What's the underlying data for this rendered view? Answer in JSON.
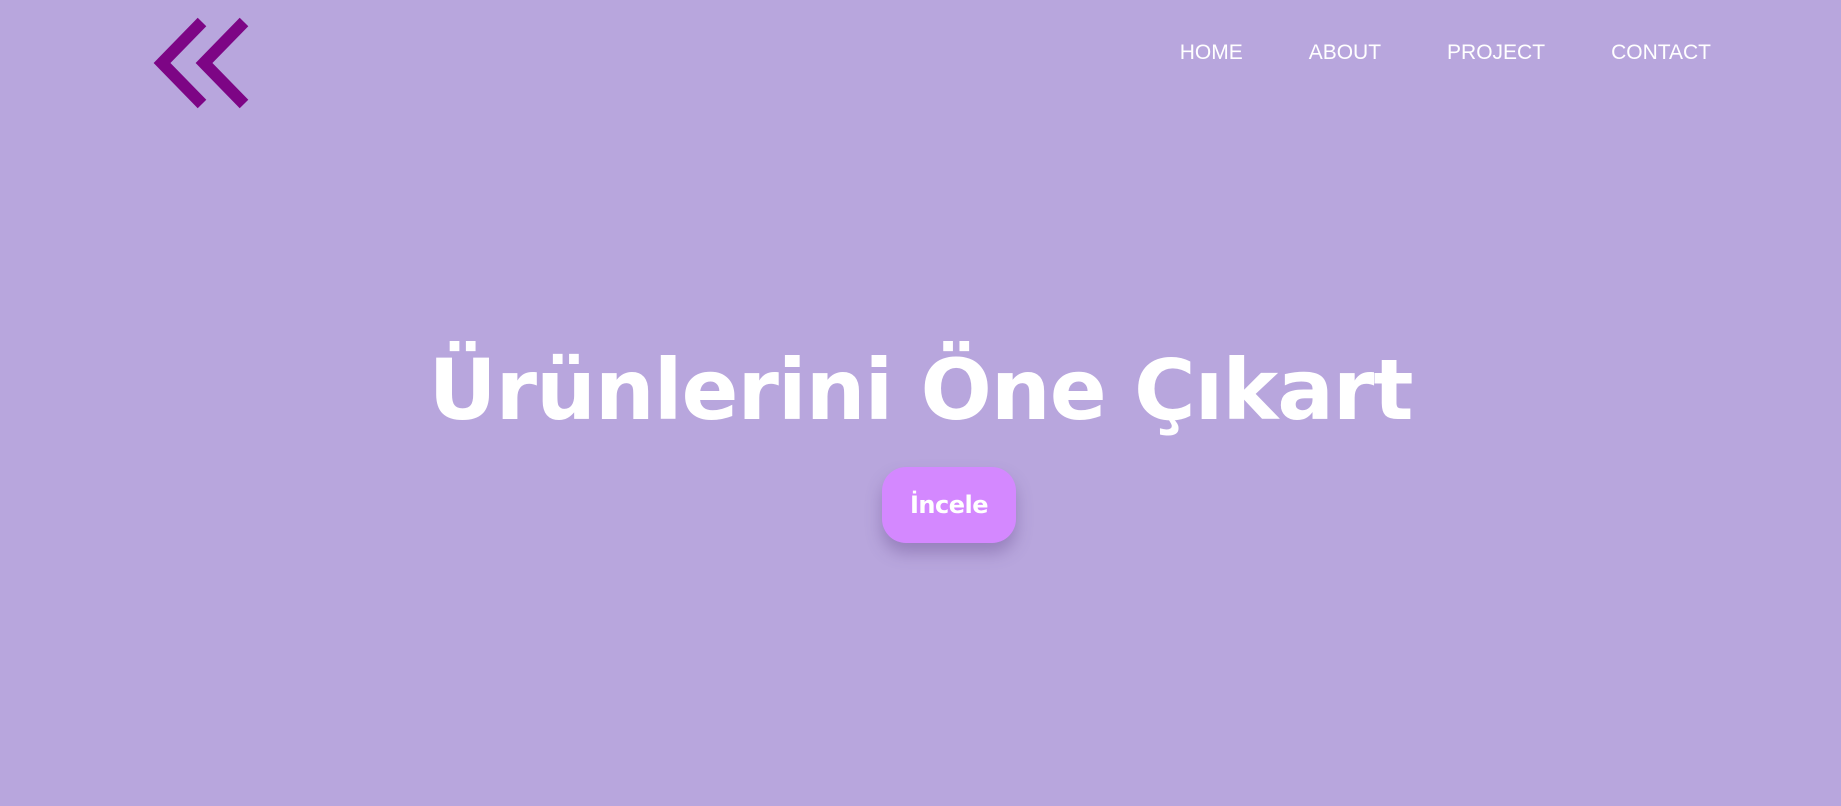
{
  "theme": {
    "background": "#b8a6dd",
    "logo_color": "#7d0585",
    "button_color": "#d488ff",
    "text_color": "#ffffff"
  },
  "logo": {
    "icon": "double-chevron-left-icon"
  },
  "nav": {
    "items": [
      {
        "label": "HOME"
      },
      {
        "label": "ABOUT"
      },
      {
        "label": "PROJECT"
      },
      {
        "label": "CONTACT"
      }
    ]
  },
  "hero": {
    "title": "Ürünlerini Öne Çıkart",
    "button_label": "İncele"
  }
}
